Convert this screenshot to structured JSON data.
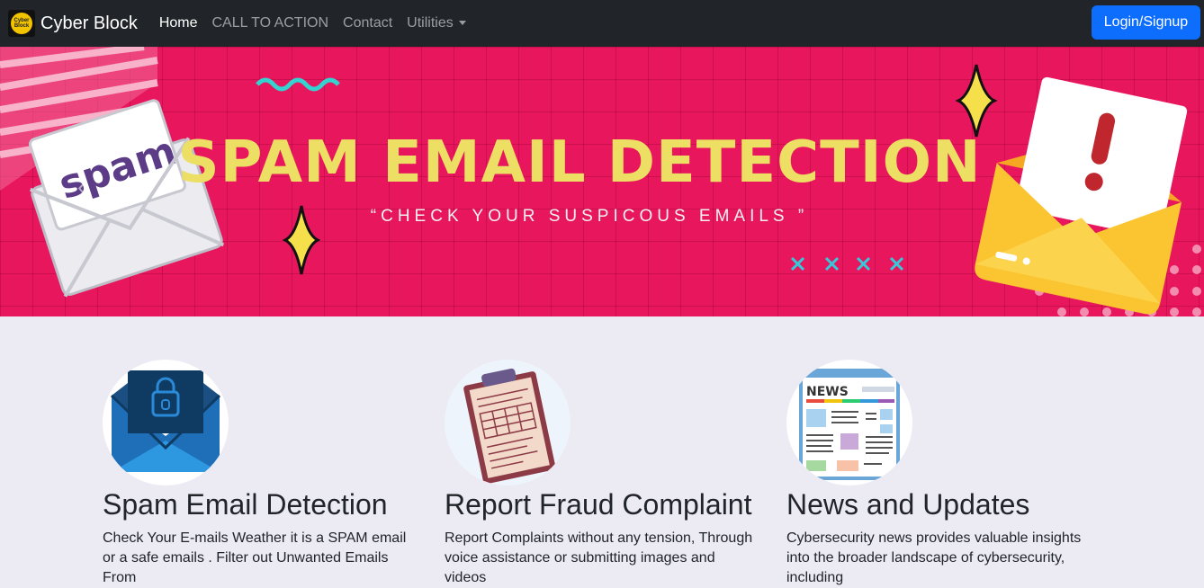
{
  "navbar": {
    "logo_text": "Cyber Block",
    "brand": "Cyber Block",
    "links": [
      "Home",
      "CALL TO ACTION",
      "Contact",
      "Utilities"
    ],
    "login_label": "Login/Signup"
  },
  "banner": {
    "title": "SPAM EMAIL DETECTION",
    "subtitle": "“CHECK YOUR SUSPICOUS EMAILS ”",
    "envelope_word": "spam",
    "prev_glyph": "‹",
    "next_glyph": "›",
    "colors": {
      "background": "#e8175d",
      "title": "#ecdf63"
    }
  },
  "cards": [
    {
      "icon": "locked-envelope-icon",
      "title": "Spam Email Detection",
      "text": "Check Your E-mails Weather it is a SPAM email or a safe emails . Filter out Unwanted Emails From"
    },
    {
      "icon": "clipboard-icon",
      "title": "Report Fraud Complaint",
      "text": "Report Complaints without any tension, Through voice assistance or submitting images and videos"
    },
    {
      "icon": "newspaper-icon",
      "title": "News and Updates",
      "text": "Cybersecurity news provides valuable insights into the broader landscape of cybersecurity, including",
      "news_label": "NEWS"
    }
  ]
}
